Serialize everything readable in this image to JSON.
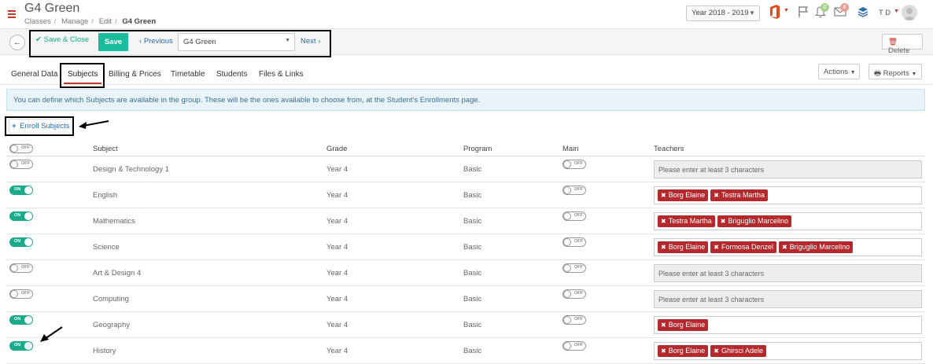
{
  "header": {
    "title": "G4 Green",
    "breadcrumb": [
      "Classes",
      "Manage",
      "Edit",
      "G4 Green"
    ],
    "year": "Year 2018 - 2019",
    "notif_count": "0",
    "mail_count": "8",
    "user_initials": "T D"
  },
  "toolbar": {
    "save_close_label": "Save & Close",
    "save_label": "Save",
    "previous_label": "Previous",
    "group_value": "G4 Green",
    "next_label": "Next",
    "delete_label": "Delete"
  },
  "tabs": [
    {
      "label": "General Data"
    },
    {
      "label": "Subjects"
    },
    {
      "label": "Billing & Prices"
    },
    {
      "label": "Timetable"
    },
    {
      "label": "Students"
    },
    {
      "label": "Files & Links"
    }
  ],
  "actions_label": "Actions",
  "reports_label": "Reports",
  "info_text": "You can define which Subjects are available in the group. These will be the ones available to choose from, at the Student's Enrollments page.",
  "enroll_label": "Enroll Subjects",
  "table": {
    "headers": {
      "subject": "Subject",
      "grade": "Grade",
      "program": "Program",
      "main": "Main",
      "teachers": "Teachers"
    },
    "toggle_on_label": "ON",
    "toggle_off_label": "OFF",
    "placeholder": "Please enter at least 3 characters",
    "rows": [
      {
        "enabled": false,
        "subject": "Design & Technology 1",
        "grade": "Year 4",
        "program": "Basic",
        "main": false,
        "teachers": []
      },
      {
        "enabled": true,
        "subject": "English",
        "grade": "Year 4",
        "program": "Basic",
        "main": false,
        "teachers": [
          "Borg Elaine",
          "Testra Martha"
        ]
      },
      {
        "enabled": true,
        "subject": "Mathematics",
        "grade": "Year 4",
        "program": "Basic",
        "main": false,
        "teachers": [
          "Testra Martha",
          "Briguglio Marcelino"
        ]
      },
      {
        "enabled": true,
        "subject": "Science",
        "grade": "Year 4",
        "program": "Basic",
        "main": false,
        "teachers": [
          "Borg Elaine",
          "Formosa Denzel",
          "Briguglio Marcelino"
        ]
      },
      {
        "enabled": false,
        "subject": "Art & Design 4",
        "grade": "Year 4",
        "program": "Basic",
        "main": false,
        "teachers": []
      },
      {
        "enabled": false,
        "subject": "Computing",
        "grade": "Year 4",
        "program": "Basic",
        "main": false,
        "teachers": []
      },
      {
        "enabled": true,
        "subject": "Geography",
        "grade": "Year 4",
        "program": "Basic",
        "main": false,
        "teachers": [
          "Borg Elaine"
        ]
      },
      {
        "enabled": true,
        "subject": "History",
        "grade": "Year 4",
        "program": "Basic",
        "main": false,
        "teachers": [
          "Borg Elaine",
          "Ghirsci Adele"
        ]
      }
    ]
  }
}
